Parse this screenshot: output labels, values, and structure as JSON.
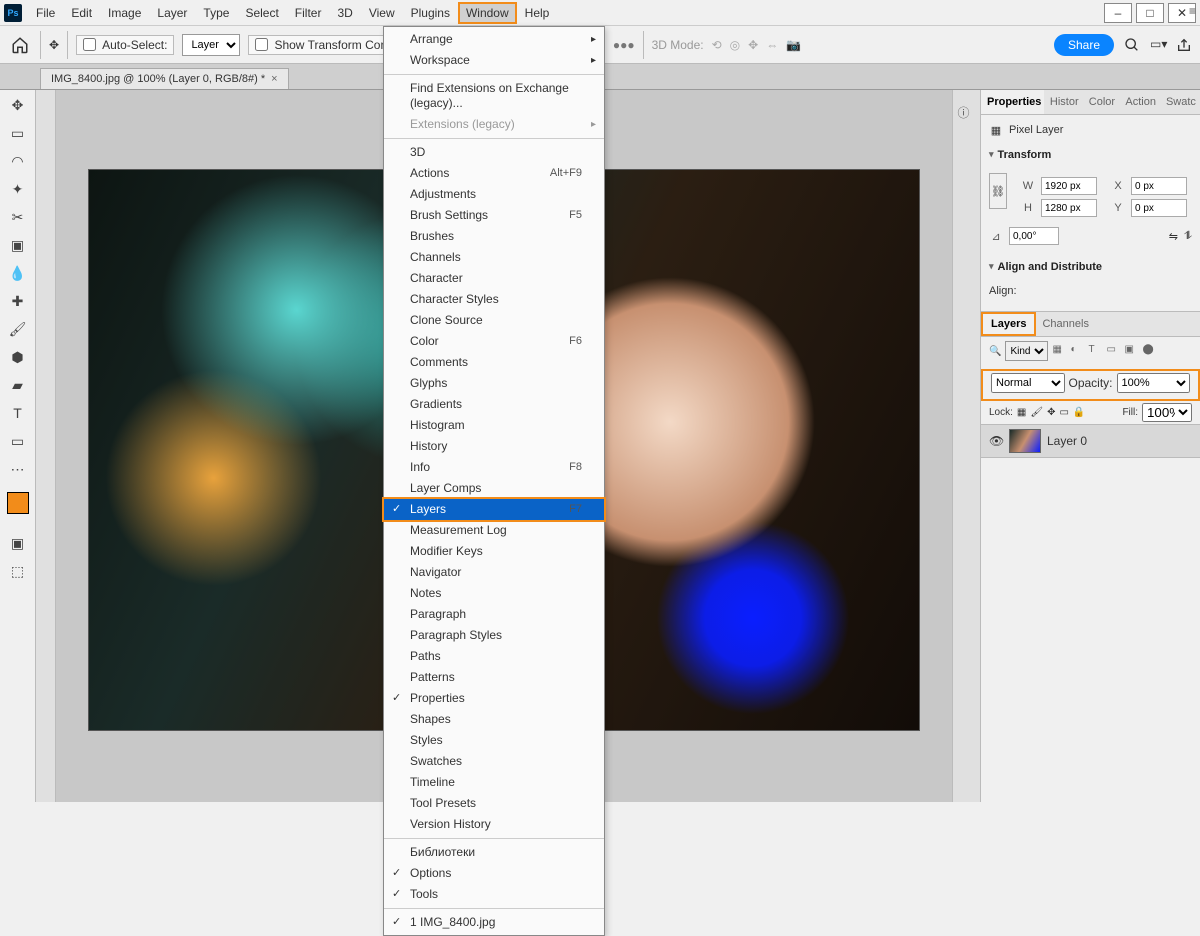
{
  "app": {
    "icon": "Ps"
  },
  "menubar": {
    "items": [
      "File",
      "Edit",
      "Image",
      "Layer",
      "Type",
      "Select",
      "Filter",
      "3D",
      "View",
      "Plugins",
      "Window",
      "Help"
    ],
    "active_index": 10
  },
  "window_controls": {
    "minimize": "–",
    "maximize": "□",
    "close": "✕"
  },
  "optionsbar": {
    "auto_select_label": "Auto-Select:",
    "auto_select_target": "Layer",
    "show_transform": "Show Transform Controls",
    "threeD_mode": "3D Mode:",
    "share": "Share"
  },
  "doc_tab": {
    "title": "IMG_8400.jpg @ 100% (Layer 0, RGB/8#) *",
    "close": "×"
  },
  "dropdown": {
    "items": [
      {
        "label": "Arrange",
        "type": "sub"
      },
      {
        "label": "Workspace",
        "type": "sub"
      },
      {
        "label": "---"
      },
      {
        "label": "Find Extensions on Exchange (legacy)..."
      },
      {
        "label": "Extensions (legacy)",
        "type": "sub",
        "disabled": true
      },
      {
        "label": "---"
      },
      {
        "label": "3D"
      },
      {
        "label": "Actions",
        "shortcut": "Alt+F9"
      },
      {
        "label": "Adjustments"
      },
      {
        "label": "Brush Settings",
        "shortcut": "F5"
      },
      {
        "label": "Brushes"
      },
      {
        "label": "Channels"
      },
      {
        "label": "Character"
      },
      {
        "label": "Character Styles"
      },
      {
        "label": "Clone Source"
      },
      {
        "label": "Color",
        "shortcut": "F6"
      },
      {
        "label": "Comments"
      },
      {
        "label": "Glyphs"
      },
      {
        "label": "Gradients"
      },
      {
        "label": "Histogram"
      },
      {
        "label": "History"
      },
      {
        "label": "Info",
        "shortcut": "F8"
      },
      {
        "label": "Layer Comps"
      },
      {
        "label": "Layers",
        "shortcut": "F7",
        "checked": true,
        "highlight": true
      },
      {
        "label": "Measurement Log"
      },
      {
        "label": "Modifier Keys"
      },
      {
        "label": "Navigator"
      },
      {
        "label": "Notes"
      },
      {
        "label": "Paragraph"
      },
      {
        "label": "Paragraph Styles"
      },
      {
        "label": "Paths"
      },
      {
        "label": "Patterns"
      },
      {
        "label": "Properties",
        "checked": true
      },
      {
        "label": "Shapes"
      },
      {
        "label": "Styles"
      },
      {
        "label": "Swatches"
      },
      {
        "label": "Timeline"
      },
      {
        "label": "Tool Presets"
      },
      {
        "label": "Version History"
      },
      {
        "label": "---"
      },
      {
        "label": "Библиотеки"
      },
      {
        "label": "Options",
        "checked": true
      },
      {
        "label": "Tools",
        "checked": true
      },
      {
        "label": "---"
      },
      {
        "label": "1 IMG_8400.jpg",
        "checked": true
      }
    ]
  },
  "properties": {
    "tabs": [
      "Properties",
      "Histor",
      "Color",
      "Action",
      "Swatc"
    ],
    "pixel_layer": "Pixel Layer",
    "transform_head": "Transform",
    "w_label": "W",
    "w_value": "1920 px",
    "h_label": "H",
    "h_value": "1280 px",
    "x_label": "X",
    "x_value": "0 px",
    "y_label": "Y",
    "y_value": "0 px",
    "angle_label": "⊿",
    "angle_value": "0,00°",
    "align_head": "Align and Distribute",
    "align_label": "Align:"
  },
  "layers": {
    "tabs": [
      "Layers",
      "Channels"
    ],
    "kind_label": "Kind",
    "blend_mode": "Normal",
    "opacity_label": "Opacity:",
    "opacity_value": "100%",
    "lock_label": "Lock:",
    "fill_label": "Fill:",
    "fill_value": "100%",
    "layer_name": "Layer 0"
  }
}
